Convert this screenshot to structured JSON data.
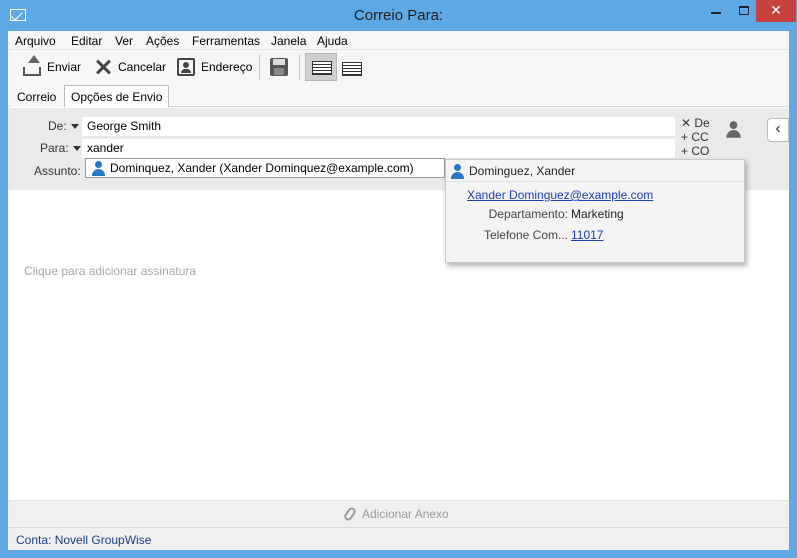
{
  "window": {
    "title": "Correio Para:"
  },
  "menu": [
    "Arquivo",
    "Editar",
    "Ver",
    "Ações",
    "Ferramentas",
    "Janela",
    "Ajuda"
  ],
  "toolbar": {
    "send": "Enviar",
    "cancel": "Cancelar",
    "address": "Endereço"
  },
  "tabs": [
    "Correio",
    "Opções de Envio"
  ],
  "fields": {
    "from_label": "De:",
    "from_value": "George Smith",
    "to_label": "Para:",
    "to_value": "xander",
    "subject_label": "Assunto:"
  },
  "recipient_types": [
    "De",
    "CC",
    "CO"
  ],
  "suggestion": {
    "text": "Dominquez, Xander (Xander Dominquez@example.com)"
  },
  "popup": {
    "name": "Dominguez, Xander",
    "email": "Xander Dominguez@example.com",
    "dept_label": "Departamento:",
    "dept_value": "Marketing",
    "phone_label": "Telefone Com...",
    "phone_value": "11017"
  },
  "body": {
    "signature_placeholder": "Clique para adicionar assinatura"
  },
  "attach": {
    "label": "Adicionar Anexo"
  },
  "status": {
    "text": "Conta: Novell GroupWise"
  }
}
